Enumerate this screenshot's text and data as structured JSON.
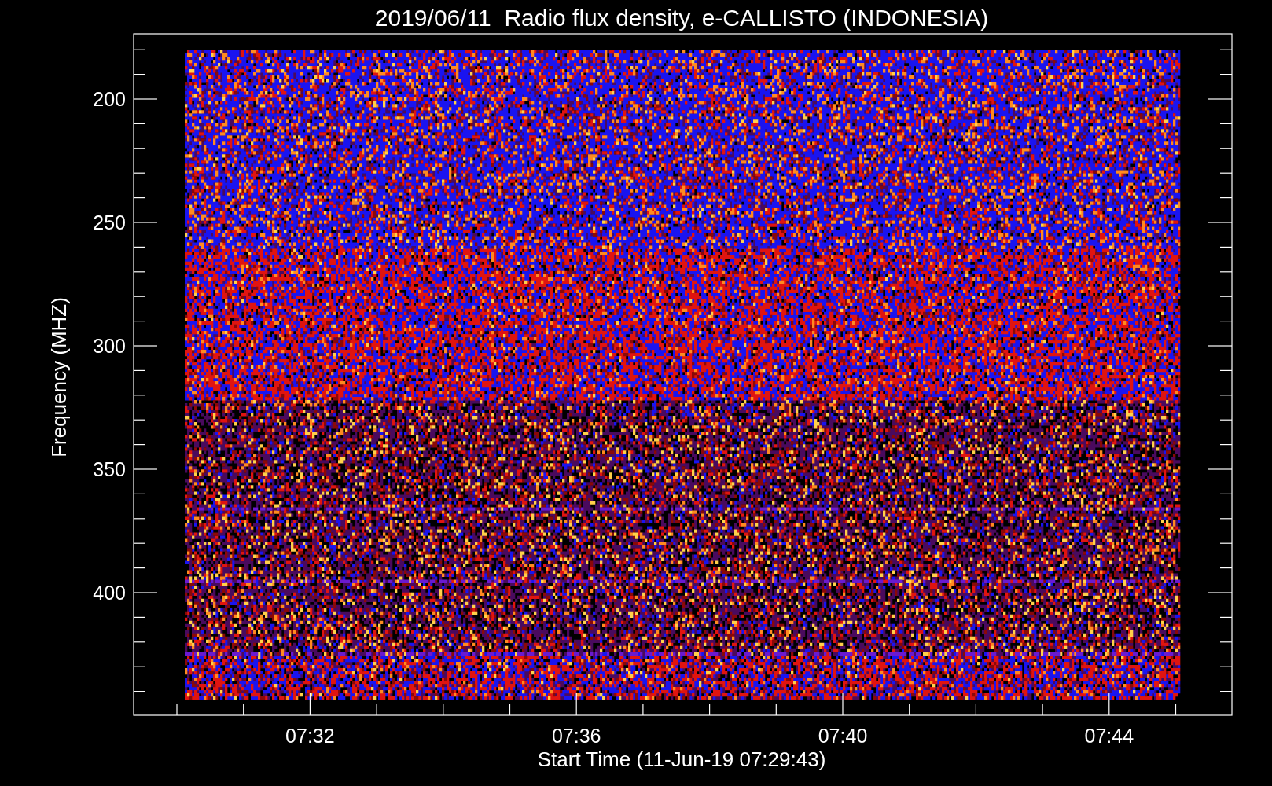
{
  "title": "2019/06/11  Radio flux density, e-CALLISTO (INDONESIA)",
  "ylabel": "Frequency (MHZ)",
  "xlabel": "Start Time (11-Jun-19 07:29:43)",
  "yticks": [
    "200",
    "250",
    "300",
    "350",
    "400"
  ],
  "xticks": [
    "07:32",
    "07:36",
    "07:40",
    "07:44"
  ]
}
